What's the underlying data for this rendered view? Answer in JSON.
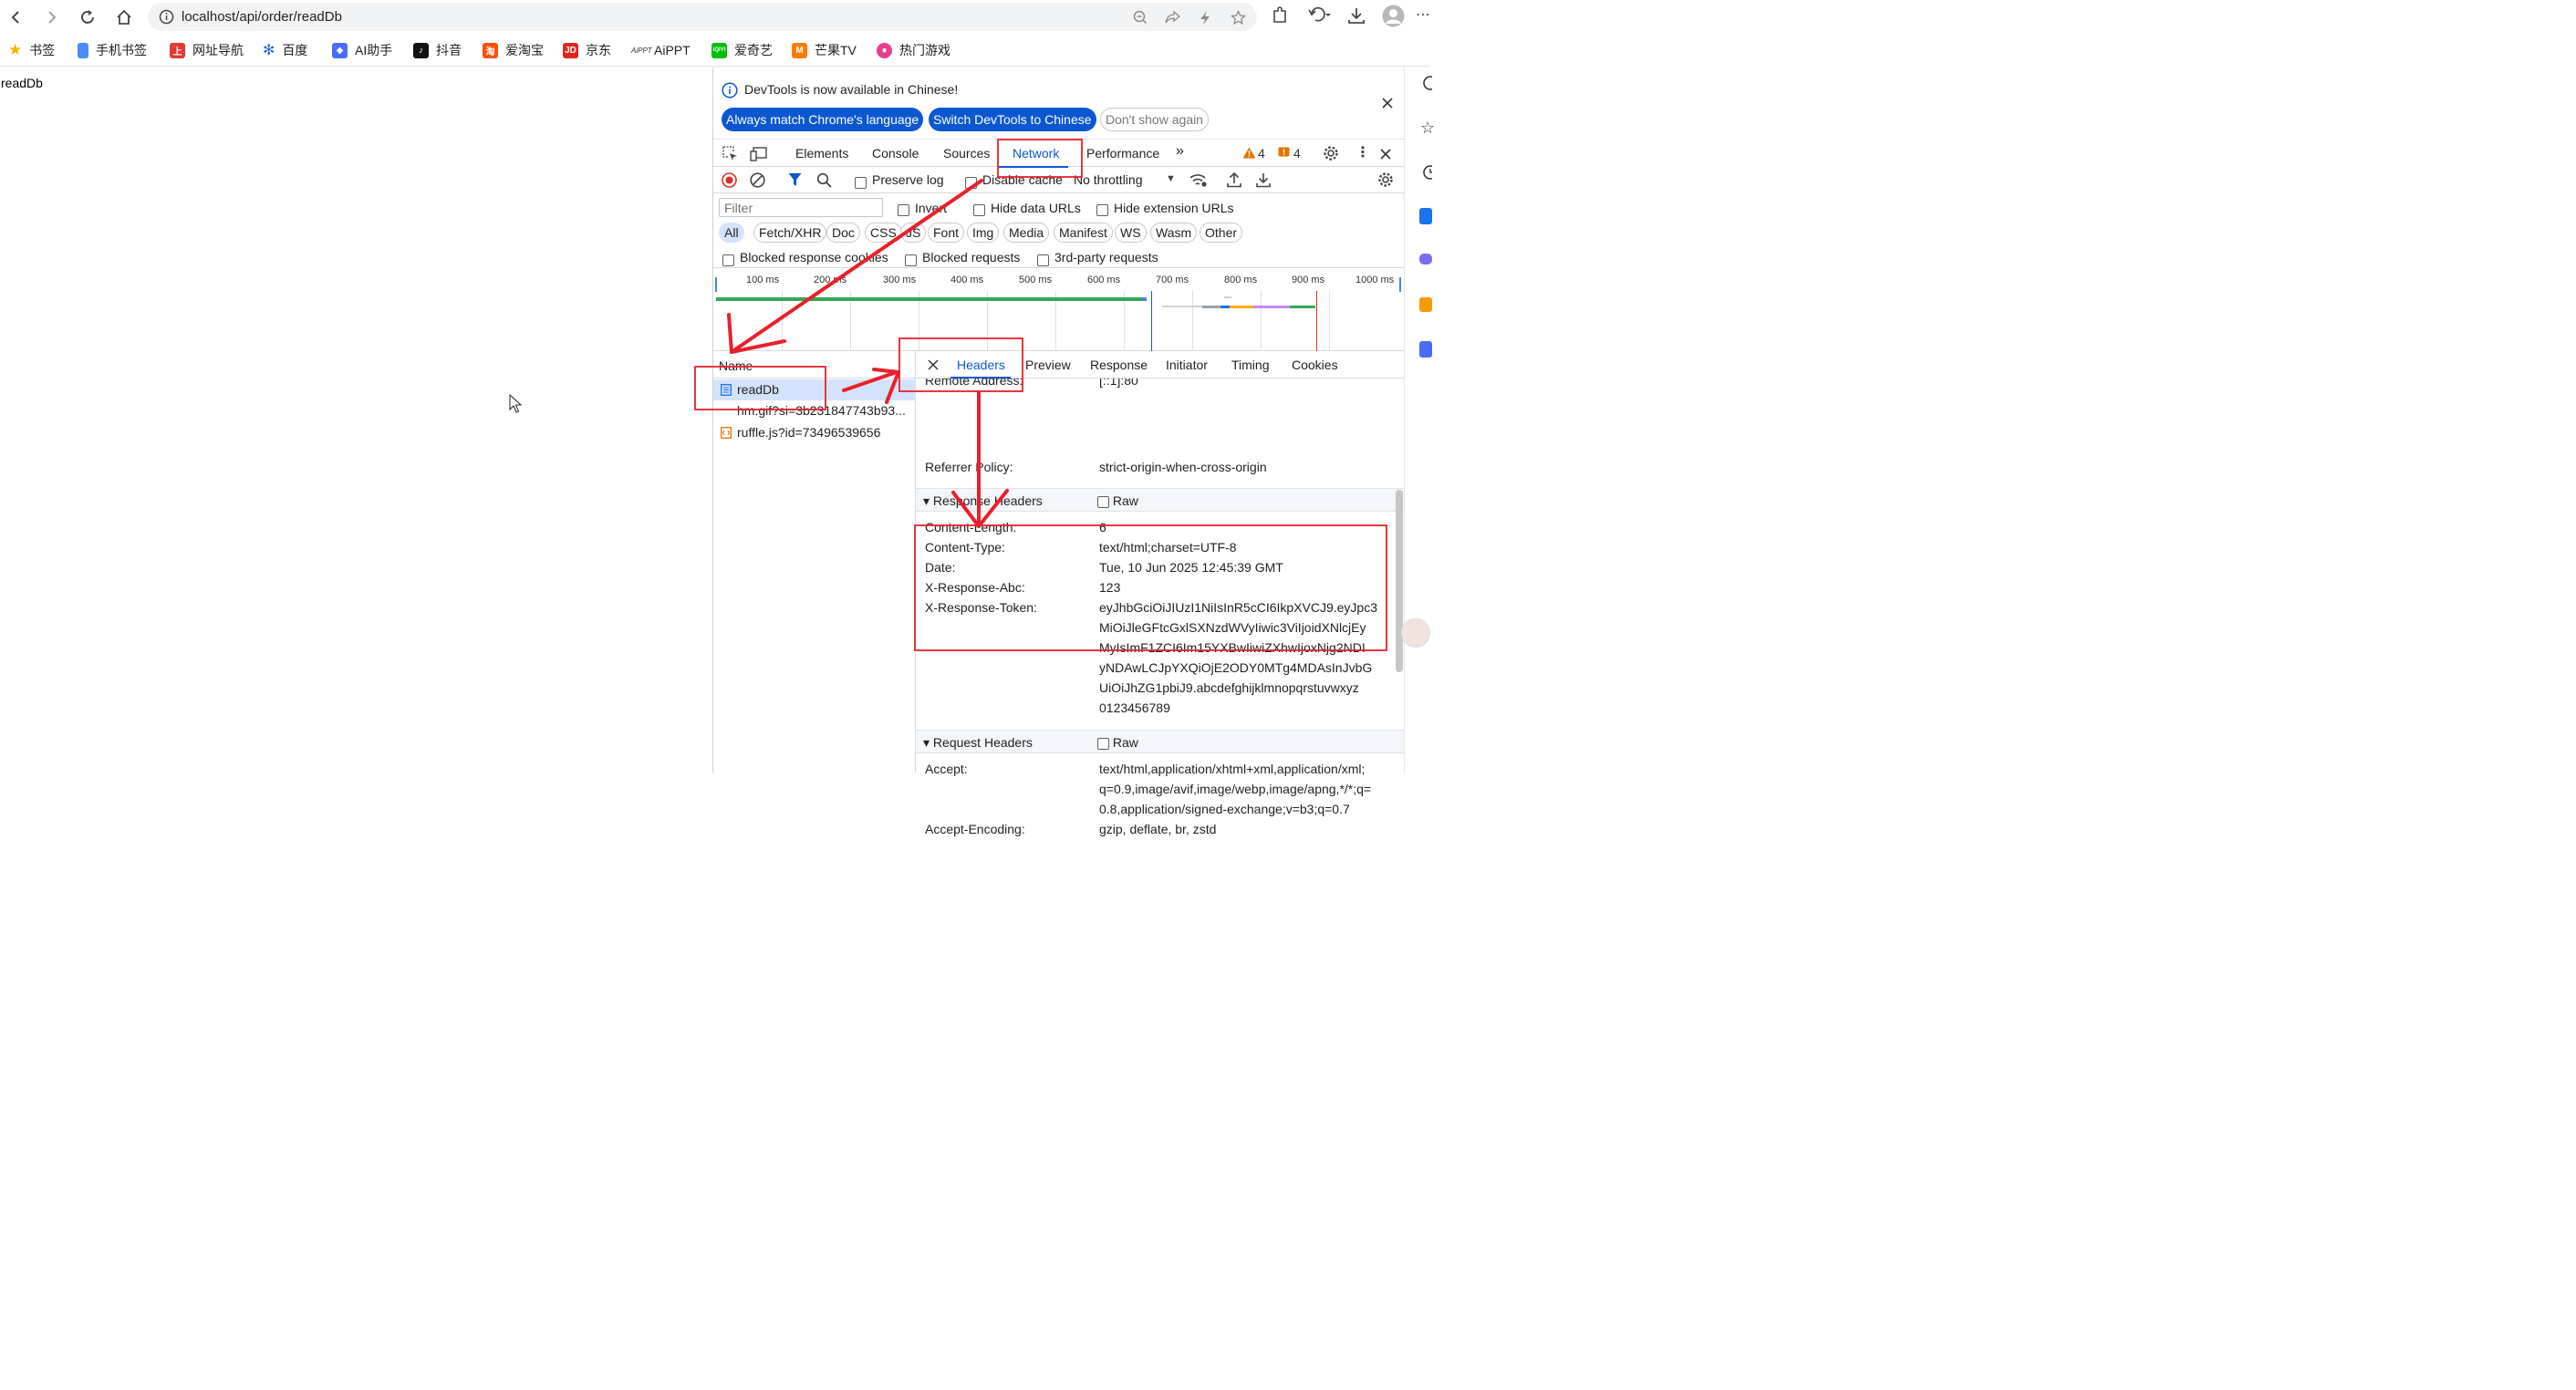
{
  "browser": {
    "url": "localhost/api/order/readDb",
    "bookmarks": [
      {
        "label": "书签",
        "color": "#f6b400"
      },
      {
        "label": "手机书签",
        "color": "#4a8df6"
      },
      {
        "label": "网址导航",
        "color": "#e53935"
      },
      {
        "label": "百度",
        "color": "#2a62e6"
      },
      {
        "label": "AI助手",
        "color": "#4a6cf7"
      },
      {
        "label": "抖音",
        "color": "#111111"
      },
      {
        "label": "爱淘宝",
        "color": "#ff5000"
      },
      {
        "label": "京东",
        "color": "#e1251b"
      },
      {
        "label": "AiPPT",
        "color": "#333333"
      },
      {
        "label": "爱奇艺",
        "color": "#00be06"
      },
      {
        "label": "芒果TV",
        "color": "#ff7a00"
      },
      {
        "label": "热门游戏",
        "color": "#e83e8c"
      }
    ]
  },
  "page": {
    "body_text": "readDb"
  },
  "devtools": {
    "info_message": "DevTools is now available in Chinese!",
    "btn_match_language": "Always match Chrome's language",
    "btn_switch_chinese": "Switch DevTools to Chinese",
    "btn_dont_show": "Don't show again",
    "tabs": [
      "Elements",
      "Console",
      "Sources",
      "Network",
      "Performance"
    ],
    "active_tab": "Network",
    "warning_count": "4",
    "error_count": "4",
    "preserve_log": "Preserve log",
    "disable_cache": "Disable cache",
    "throttling": "No throttling",
    "filter_placeholder": "Filter",
    "invert": "Invert",
    "hide_data_urls": "Hide data URLs",
    "hide_extension_urls": "Hide extension URLs",
    "type_filters": [
      "All",
      "Fetch/XHR",
      "Doc",
      "CSS",
      "JS",
      "Font",
      "Img",
      "Media",
      "Manifest",
      "WS",
      "Wasm",
      "Other"
    ],
    "blocked_response_cookies": "Blocked response cookies",
    "blocked_requests": "Blocked requests",
    "third_party_requests": "3rd-party requests",
    "timeline_ticks": [
      "100 ms",
      "200 ms",
      "300 ms",
      "400 ms",
      "500 ms",
      "600 ms",
      "700 ms",
      "800 ms",
      "900 ms",
      "1000 ms"
    ],
    "name_header": "Name",
    "requests": [
      {
        "name": "readDb",
        "selected": true
      },
      {
        "name": "hm.gif?si=3b231847743b93...",
        "selected": false
      },
      {
        "name": "ruffle.js?id=73496539656",
        "selected": false
      }
    ],
    "detail_tabs": [
      "Headers",
      "Preview",
      "Response",
      "Initiator",
      "Timing",
      "Cookies"
    ],
    "active_detail_tab": "Headers",
    "partial_remote_address_key": "Remote Address:",
    "partial_remote_address_val": "[::1]:80",
    "referrer_policy_key": "Referrer Policy:",
    "referrer_policy_val": "strict-origin-when-cross-origin",
    "response_headers_title": "Response Headers",
    "raw_label": "Raw",
    "response_headers": [
      {
        "key": "Content-Length:",
        "value": "6"
      },
      {
        "key": "Content-Type:",
        "value": "text/html;charset=UTF-8"
      },
      {
        "key": "Date:",
        "value": "Tue, 10 Jun 2025 12:45:39 GMT"
      },
      {
        "key": "X-Response-Abc:",
        "value": "123"
      }
    ],
    "token_key": "X-Response-Token:",
    "token_lines": [
      "eyJhbGciOiJIUzI1NiIsInR5cCI6IkpXVCJ9.eyJpc3",
      "MiOiJleGFtcGxlSXNzdWVyIiwic3ViIjoidXNlcjEy",
      "MyIsImF1ZCI6Im15YXBwIiwiZXhwIjoxNjg2NDI",
      "yNDAwLCJpYXQiOjE2ODY0MTg4MDAsInJvbG",
      "UiOiJhZG1pbiJ9.abcdefghijklmnopqrstuvwxyz",
      "0123456789"
    ],
    "request_headers_title": "Request Headers",
    "accept_key": "Accept:",
    "accept_lines": [
      "text/html,application/xhtml+xml,application/xml;",
      "q=0.9,image/avif,image/webp,image/apng,*/*;q=",
      "0.8,application/signed-exchange;v=b3;q=0.7"
    ],
    "accept_encoding_key": "Accept-Encoding:",
    "accept_encoding_val": "gzip, deflate, br, zstd"
  },
  "colors": {
    "accent": "#0b57d0",
    "annotation": "#e8202a",
    "selected_bg": "#d3e3fd"
  }
}
